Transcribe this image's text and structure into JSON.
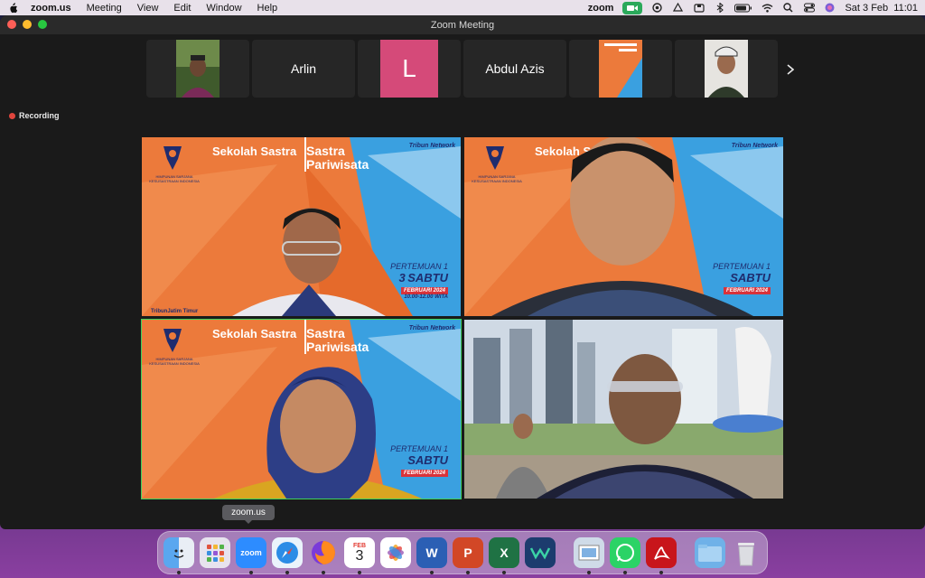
{
  "menubar": {
    "app": "zoom.us",
    "items": [
      "Meeting",
      "View",
      "Edit",
      "Window",
      "Help"
    ],
    "zoom_label": "zoom",
    "datetime": "Sat 3 Feb  11:01"
  },
  "window": {
    "title": "Zoom Meeting"
  },
  "filmstrip": {
    "participants": [
      {
        "name": "",
        "type": "video",
        "icon": "participant-video"
      },
      {
        "name": "Arlin",
        "type": "name"
      },
      {
        "name": "L",
        "type": "initial",
        "color": "#d54a79"
      },
      {
        "name": "Abdul Azis",
        "type": "name"
      },
      {
        "name": "",
        "type": "slide",
        "icon": "sekolah-sastra-slide"
      },
      {
        "name": "",
        "type": "video",
        "icon": "participant-video"
      }
    ]
  },
  "recording": {
    "label": "Recording",
    "color": "#e0453d"
  },
  "tiles": {
    "title_left": "Sekolah Sastra",
    "title_right_1": "Sastra",
    "title_right_2": "Pariwisata",
    "org": "HIMPUNAN SARJANA KESUSASTRAAN INDONESIA",
    "network": "Tribun Network",
    "event_line": "PERTEMUAN 1",
    "day": "SABTU",
    "day_num": "3",
    "date": "FEBRUARI 2024",
    "time": "10.00-12.00 WITA",
    "footer": "TribunJatim Timur"
  },
  "tooltip": {
    "label": "zoom.us"
  },
  "dock": {
    "calendar_month": "FEB",
    "calendar_day": "3",
    "apps": [
      "finder",
      "launchpad",
      "zoom",
      "safari",
      "firefox",
      "calendar",
      "photos",
      "word",
      "powerpoint",
      "excel",
      "webex",
      "preview",
      "whatsapp",
      "acrobat",
      "downloads",
      "trash"
    ]
  },
  "colors": {
    "active_speaker": "#3ed15c",
    "banner_orange": "#ec7a3b",
    "banner_blue": "#3aa0e0"
  }
}
